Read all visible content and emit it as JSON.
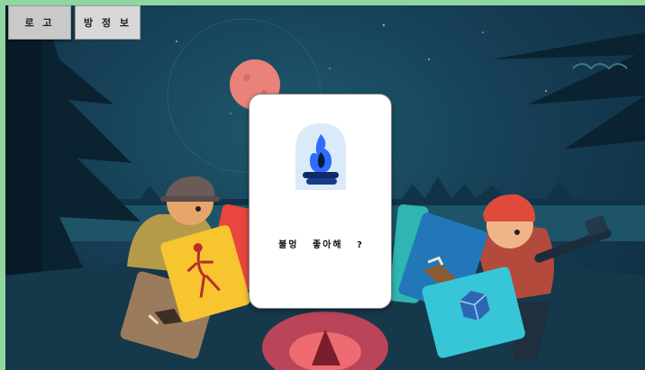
{
  "toolbar": {
    "back_label": "로 고",
    "room_info_label": "방 정 보"
  },
  "card": {
    "icon": "campfire-icon",
    "question": "불멍 좋아해 ?"
  },
  "colors": {
    "background": "#163f55",
    "moon": "#e9827a",
    "fire_blue": "#2f6bff",
    "card_yellow": "#f6c530",
    "card_red": "#e8463f",
    "card_cyan": "#36c6d8",
    "card_teal": "#2fb5b2",
    "card_blue": "#2277b8",
    "card_brown": "#9a7b5b"
  }
}
